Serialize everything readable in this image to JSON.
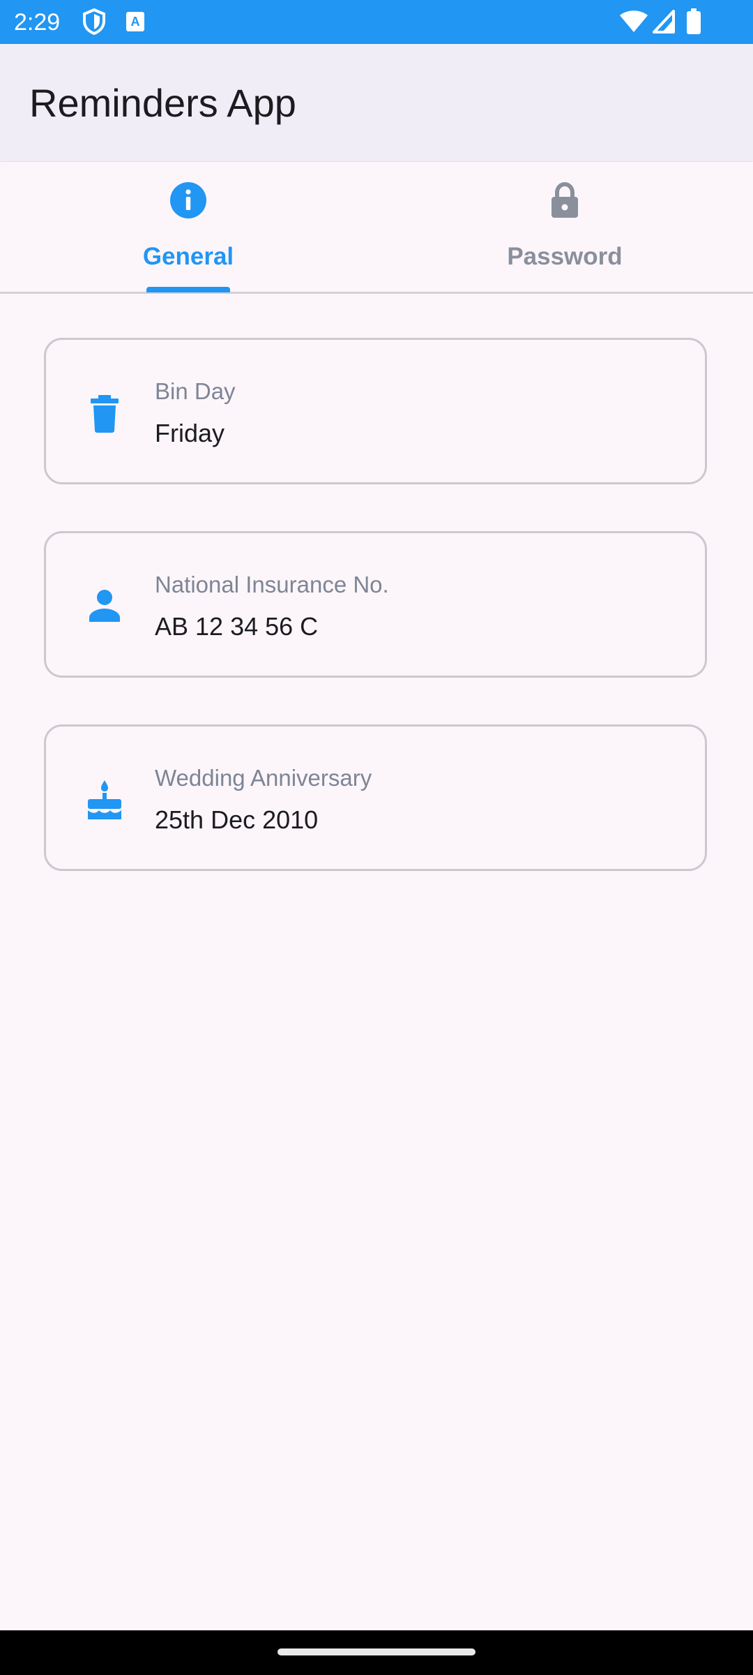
{
  "status_bar": {
    "time": "2:29",
    "color": "#2196F3",
    "left_icons": [
      "shield-icon",
      "keyboard-a-icon"
    ],
    "right_icons": [
      "wifi-icon",
      "signal-icon",
      "battery-icon"
    ]
  },
  "app_bar": {
    "title": "Reminders App"
  },
  "tabs": [
    {
      "label": "General",
      "icon": "info-icon",
      "selected": true
    },
    {
      "label": "Password",
      "icon": "lock-icon",
      "selected": false
    }
  ],
  "cards": [
    {
      "label": "Bin Day",
      "value": "Friday",
      "icon": "trash-icon"
    },
    {
      "label": "National Insurance No.",
      "value": "AB 12 34 56 C",
      "icon": "person-icon"
    },
    {
      "label": "Wedding Anniversary",
      "value": "25th Dec 2010",
      "icon": "cake-icon"
    }
  ],
  "colors": {
    "accent": "#2196F3",
    "inactive_tab": "#8A8F9C",
    "background": "#FCF6FB"
  }
}
